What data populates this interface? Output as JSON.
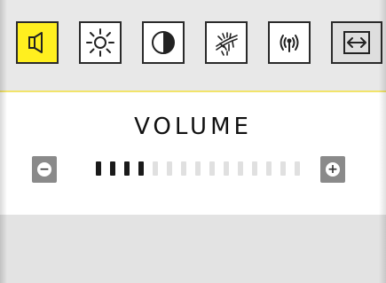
{
  "app": {
    "screen_title": "VOLUME"
  },
  "icons": [
    {
      "name": "speaker-icon",
      "active": true
    },
    {
      "name": "brightness-icon",
      "active": false
    },
    {
      "name": "contrast-icon",
      "active": false
    },
    {
      "name": "phosphor-icon",
      "active": false
    },
    {
      "name": "signal-icon",
      "active": false
    },
    {
      "name": "horizontal-position-icon",
      "active": false,
      "partial": true
    }
  ],
  "volume": {
    "level": 4,
    "steps": 15,
    "minus_symbol": "−",
    "plus_symbol": "+"
  },
  "colors": {
    "active_tile": "#ffef1f",
    "divider": "#f2e46b",
    "topbar_bg": "#e8e8e8",
    "bottom_bg": "#e3e3e3",
    "filled_tick": "#1a1a1a",
    "empty_tick": "#e0e0e0"
  }
}
